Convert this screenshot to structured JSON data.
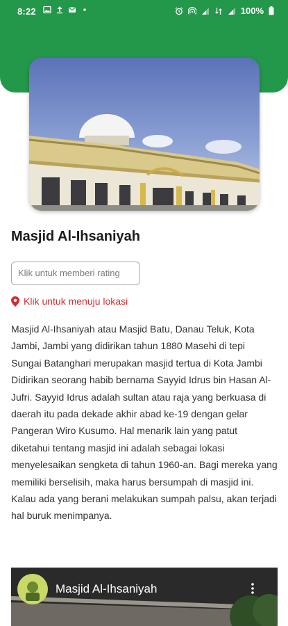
{
  "status_bar": {
    "time": "8:22",
    "battery": "100%",
    "left_icons": [
      "image-icon",
      "upload-icon",
      "mail-icon",
      "dot-icon"
    ],
    "right_icons": [
      "alarm-icon",
      "hotspot-icon",
      "signal-icon",
      "data-icon",
      "signal-icon"
    ]
  },
  "place": {
    "title": "Masjid Al-Ihsaniyah",
    "rating_placeholder": "Klik untuk memberi rating",
    "location_link": "Klik untuk menuju lokasi",
    "description": "Masjid Al-Ihsaniyah atau Masjid Batu, Danau Teluk, Kota Jambi, Jambi yang didirikan tahun 1880 Masehi di tepi Sungai Batanghari merupakan masjid tertua di Kota Jambi Didirikan seorang habib bernama Sayyid Idrus bin Hasan Al-Jufri. Sayyid Idrus adalah sultan atau raja yang berkuasa di daerah itu pada dekade akhir abad ke-19 dengan gelar Pangeran Wiro Kusumo. Hal menarik lain yang patut diketahui tentang masjid ini adalah sebagai lokasi menyelesaikan sengketa di tahun 1960-an. Bagi mereka yang memiliki berselisih, maka harus bersumpah di masjid ini. Kalau ada yang berani melakukan sumpah palsu, akan terjadi hal buruk menimpanya."
  },
  "video": {
    "title": "Masjid Al-Ihsaniyah"
  },
  "colors": {
    "header": "#23974a",
    "link": "#d32f2f"
  }
}
